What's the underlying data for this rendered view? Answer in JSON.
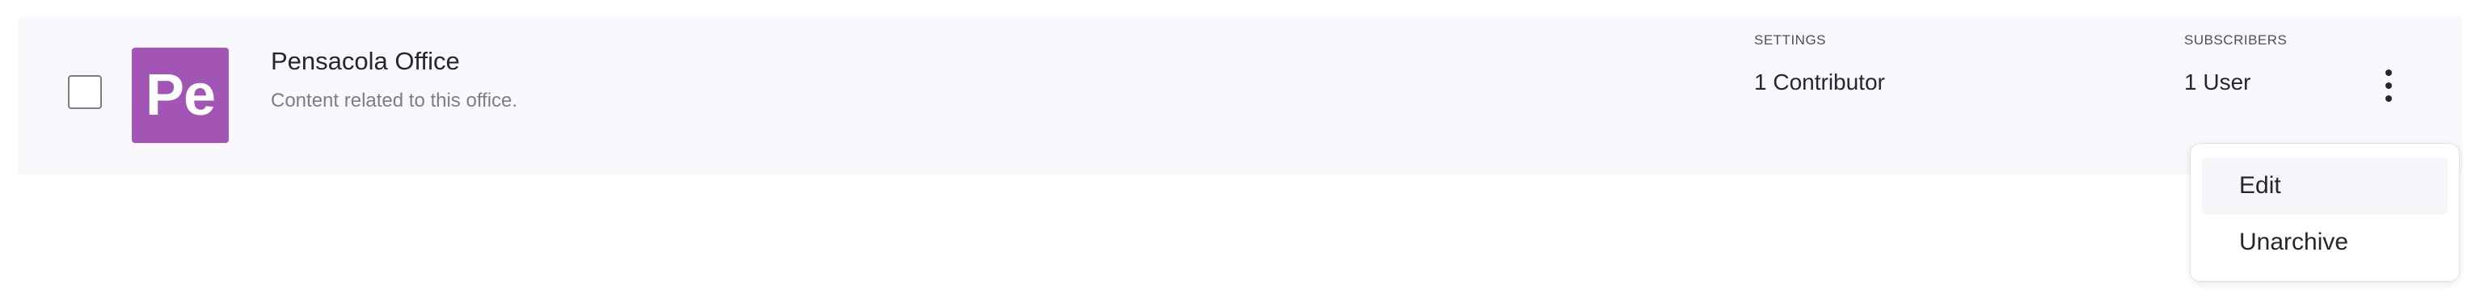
{
  "office": {
    "avatar_initials": "Pe",
    "avatar_color": "#a355b5",
    "title": "Pensacola Office",
    "description": "Content related to this office."
  },
  "settings": {
    "label": "SETTINGS",
    "value": "1 Contributor"
  },
  "subscribers": {
    "label": "SUBSCRIBERS",
    "value": "1 User"
  },
  "menu": {
    "items": [
      {
        "label": "Edit"
      },
      {
        "label": "Unarchive"
      }
    ]
  }
}
